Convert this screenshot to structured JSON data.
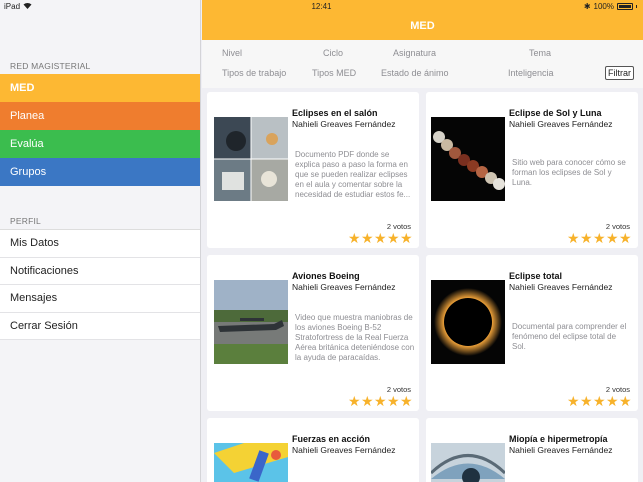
{
  "status": {
    "device": "iPad",
    "time": "12:41",
    "battery": "100%"
  },
  "sidebar": {
    "section1": "RED MAGISTERIAL",
    "nav": [
      {
        "label": "MED"
      },
      {
        "label": "Planea"
      },
      {
        "label": "Evalúa"
      },
      {
        "label": "Grupos"
      }
    ],
    "section2": "PERFIL",
    "profile": [
      {
        "label": "Mis Datos"
      },
      {
        "label": "Notificaciones"
      },
      {
        "label": "Mensajes"
      },
      {
        "label": "Cerrar Sesión"
      }
    ]
  },
  "header": {
    "title": "MED"
  },
  "filters": {
    "row1": [
      "Nivel",
      "Ciclo",
      "Asignatura",
      "Tema"
    ],
    "row2": [
      "Tipos de trabajo",
      "Tipos MED",
      "Estado de ánimo",
      "Inteligencia"
    ],
    "button": "Filtrar"
  },
  "cards": [
    {
      "title": "Eclipses en el salón",
      "author": "Nahieli Greaves Fernández",
      "description": "Documento PDF donde se explica paso a paso la forma en que se pueden realizar eclipses en el aula y comentar sobre la necesidad de estudiar estos fe...",
      "votes": "2 votos",
      "rating": 5,
      "image": "classroom-photo"
    },
    {
      "title": "Eclipse de Sol y Luna",
      "author": "Nahieli Greaves Fernández",
      "description": "Sitio web para conocer cómo se forman los eclipses de Sol y Luna.",
      "votes": "2 votos",
      "rating": 5,
      "image": "lunar-eclipse-sequence"
    },
    {
      "title": "Aviones Boeing",
      "author": "Nahieli Greaves Fernández",
      "description": "Video que muestra maniobras de los aviones Boeing B-52 Stratofortress de la Real Fuerza Aérea británica deteniéndose con la ayuda de  paracaídas.",
      "votes": "2 votos",
      "rating": 5,
      "image": "airplane-photo"
    },
    {
      "title": "Eclipse total",
      "author": "Nahieli Greaves Fernández",
      "description": "Documental para comprender el fenómeno del eclipse total de Sol.",
      "votes": "2 votos",
      "rating": 5,
      "image": "total-eclipse-photo"
    },
    {
      "title": "Fuerzas en acción",
      "author": "Nahieli Greaves Fernández",
      "image": "forces-illustration"
    },
    {
      "title": "Miopía e hipermetropía",
      "author": "Nahieli Greaves Fernández",
      "image": "eye-closeup-photo"
    }
  ]
}
